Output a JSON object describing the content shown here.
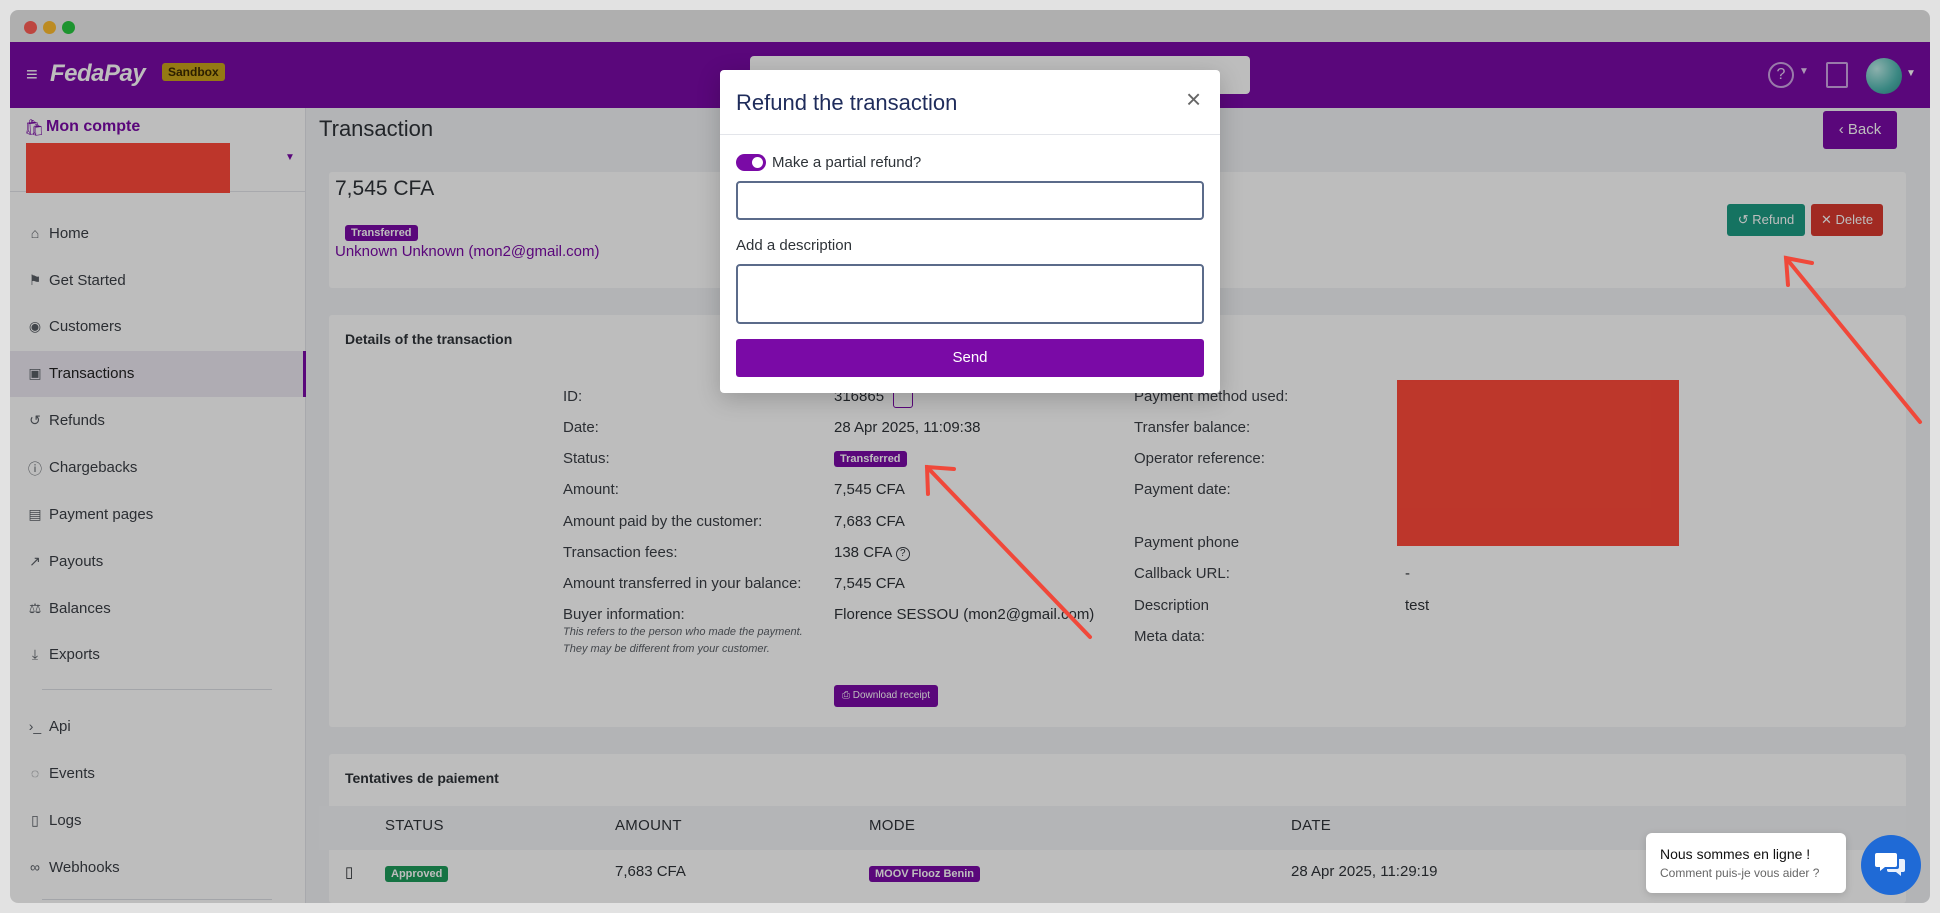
{
  "header": {
    "logo": "FedaPay",
    "env_badge": "Sandbox"
  },
  "sidebar": {
    "account_title": "Mon compte",
    "items": [
      {
        "label": "Home",
        "icon": "home-icon"
      },
      {
        "label": "Get Started",
        "icon": "flag-icon"
      },
      {
        "label": "Customers",
        "icon": "user-circle-icon"
      },
      {
        "label": "Transactions",
        "icon": "cash-icon"
      },
      {
        "label": "Refunds",
        "icon": "refund-icon"
      },
      {
        "label": "Chargebacks",
        "icon": "info-icon"
      },
      {
        "label": "Payment pages",
        "icon": "document-icon"
      },
      {
        "label": "Payouts",
        "icon": "external-link-icon"
      },
      {
        "label": "Balances",
        "icon": "scale-icon"
      },
      {
        "label": "Exports",
        "icon": "download-icon"
      },
      {
        "label": "Api",
        "icon": "terminal-icon"
      },
      {
        "label": "Events",
        "icon": "broadcast-icon"
      },
      {
        "label": "Logs",
        "icon": "file-icon"
      },
      {
        "label": "Webhooks",
        "icon": "link-icon"
      }
    ]
  },
  "page": {
    "title": "Transaction",
    "back_label": "Back",
    "amount": "7,545 CFA",
    "status_badge": "Transferred",
    "buyer_link": "Unknown Unknown (mon2@gmail.com)",
    "refund_label": "Refund",
    "delete_label": "Delete"
  },
  "details": {
    "title": "Details of the transaction",
    "left_labels": {
      "id": "ID:",
      "date": "Date:",
      "status": "Status:",
      "amount": "Amount:",
      "amount_paid": "Amount paid by the customer:",
      "fees": "Transaction fees:",
      "transferred": "Amount transferred in your balance:",
      "buyer": "Buyer information:"
    },
    "left_values": {
      "id": "316865",
      "date": "28 Apr 2025, 11:09:38",
      "status": "Transferred",
      "amount": "7,545 CFA",
      "amount_paid": "7,683 CFA",
      "fees": "138 CFA",
      "transferred": "7,545 CFA",
      "buyer": "Florence SESSOU (mon2@gmail.com)"
    },
    "buyer_note_1": "This refers to the person who made the payment.",
    "buyer_note_2": "They may be different from your customer.",
    "download_label": "Download receipt",
    "right_labels": {
      "method": "Payment method used:",
      "balance": "Transfer balance:",
      "operator_ref": "Operator reference:",
      "payment_date": "Payment date:",
      "payment_phone": "Payment phone",
      "callback": "Callback URL:",
      "description": "Description",
      "meta": "Meta data:"
    },
    "right_values": {
      "callback": "-",
      "description": "test"
    }
  },
  "attempts": {
    "title": "Tentatives de paiement",
    "columns": [
      "STATUS",
      "AMOUNT",
      "MODE",
      "DATE"
    ],
    "rows": [
      {
        "status": "Approved",
        "amount": "7,683 CFA",
        "mode": "MOOV Flooz Benin",
        "date": "28 Apr 2025, 11:29:19"
      }
    ]
  },
  "modal": {
    "title": "Refund the transaction",
    "partial_label": "Make a partial refund?",
    "partial_enabled": true,
    "amount_value": "",
    "description_label": "Add a description",
    "description_value": "",
    "send_label": "Send"
  },
  "chat": {
    "line1": "Nous sommes en ligne !",
    "line2": "Comment puis-je vous aider ?"
  },
  "colors": {
    "brand": "#7a0aa6",
    "refund": "#1d9c84",
    "delete": "#d9392e",
    "annotation_arrow": "#f0483a",
    "redaction": "#ff4a3a"
  }
}
